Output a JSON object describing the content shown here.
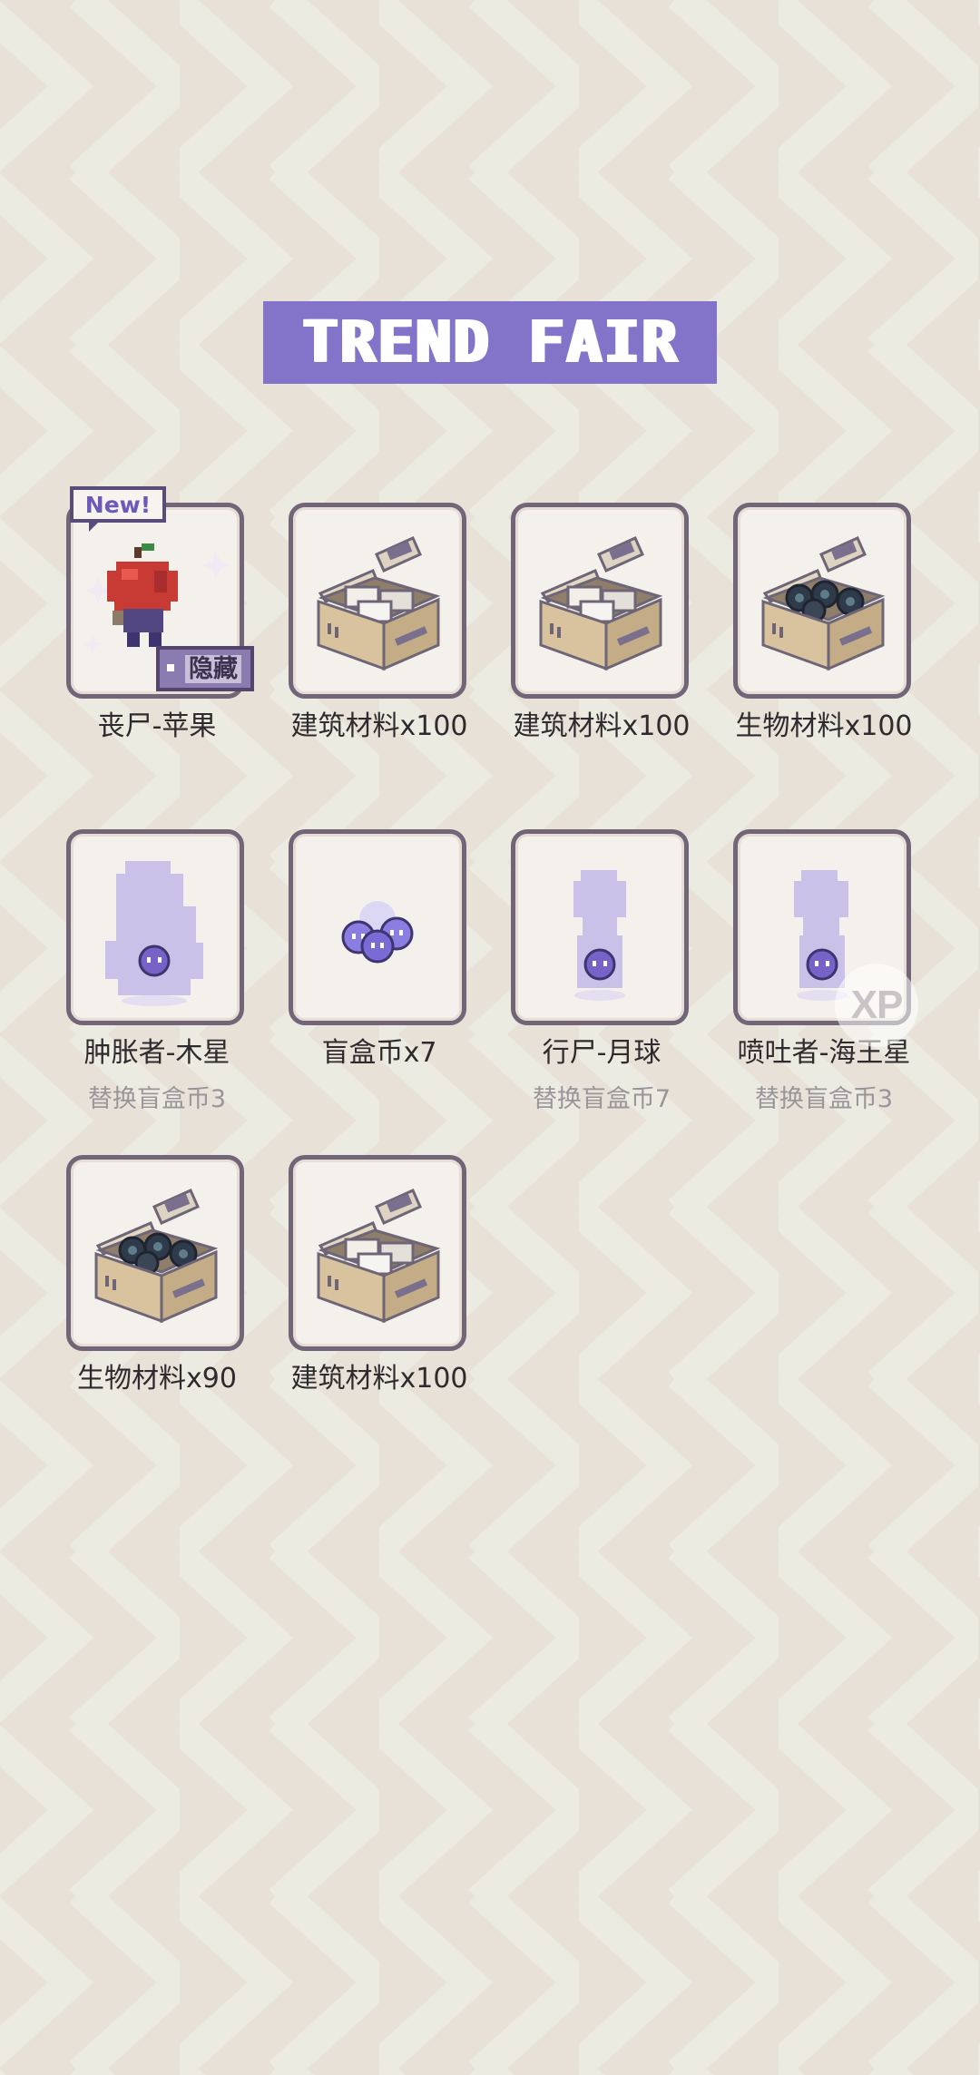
{
  "header": {
    "title": "TREND FAIR"
  },
  "items": [
    {
      "label": "丧尸-苹果",
      "art": "zombie-apple",
      "badges": {
        "new": "New!",
        "hidden": "隐藏"
      }
    },
    {
      "label": "建筑材料x100",
      "art": "crate-building"
    },
    {
      "label": "建筑材料x100",
      "art": "crate-building"
    },
    {
      "label": "生物材料x100",
      "art": "crate-bio"
    },
    {
      "label": "肿胀者-木星",
      "art": "silhouette-bloater",
      "sublabel": "替换盲盒币3"
    },
    {
      "label": "盲盒币x7",
      "art": "blindbox-coins"
    },
    {
      "label": "行尸-月球",
      "art": "silhouette-walker",
      "sublabel": "替换盲盒币7"
    },
    {
      "label": "喷吐者-海王星",
      "art": "silhouette-spitter",
      "sublabel": "替换盲盒币3"
    },
    {
      "label": "生物材料x90",
      "art": "crate-bio"
    },
    {
      "label": "建筑材料x100",
      "art": "crate-building"
    }
  ],
  "overlay": {
    "xp_badge": "XP"
  },
  "colors": {
    "accent": "#8474c9",
    "card_border": "#726578",
    "background": "#e7e1d8",
    "chevron": "#ecebe2",
    "silhouette": "#c9c1e7",
    "face": "#7763c8"
  }
}
